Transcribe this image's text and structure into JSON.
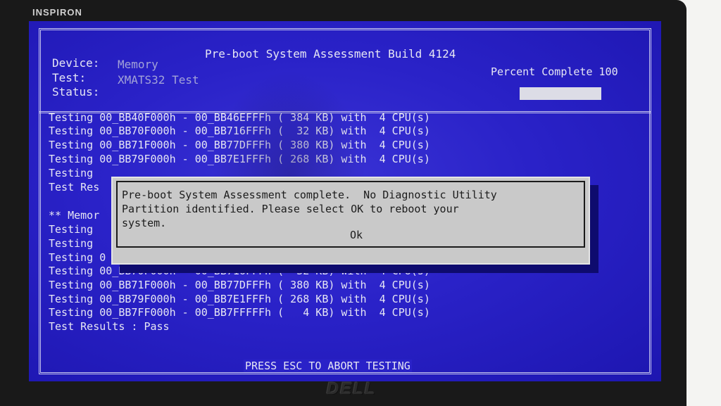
{
  "device": {
    "brand": "INSPIRON",
    "logo": "DELL"
  },
  "header": {
    "title": "Pre-boot System Assessment Build 4124",
    "device_label": "Device:",
    "device_value": "Memory",
    "test_label": "Test:",
    "test_value": "XMATS32 Test",
    "status_label": "Status:",
    "percent_label": "Percent Complete 100",
    "progress": 100
  },
  "log": {
    "lines": [
      "Testing 00_BB40F000h - 00_BB46EFFFh ( 384 KB) with  4 CPU(s)",
      "Testing 00_BB70F000h - 00_BB716FFFh (  32 KB) with  4 CPU(s)",
      "Testing 00_BB71F000h - 00_BB77DFFFh ( 380 KB) with  4 CPU(s)",
      "Testing 00_BB79F000h - 00_BB7E1FFFh ( 268 KB) with  4 CPU(s)",
      "Testing",
      "Test Res",
      "",
      "** Memor",
      "Testing",
      "Testing",
      "Testing 0",
      "Testing 00_BB70F000h - 00_BB716FFFh (  32 KB) with  4 CPU(s)",
      "Testing 00_BB71F000h - 00_BB77DFFFh ( 380 KB) with  4 CPU(s)",
      "Testing 00_BB79F000h - 00_BB7E1FFFh ( 268 KB) with  4 CPU(s)",
      "Testing 00_BB7FF000h - 00_BB7FFFFFh (   4 KB) with  4 CPU(s)",
      "Test Results : Pass"
    ]
  },
  "dialog": {
    "line1": "Pre-boot System Assessment complete.  No Diagnostic Utility",
    "line2": "Partition identified. Please select OK to reboot your",
    "line3": "system.",
    "ok_label": "Ok"
  },
  "footer": {
    "text": "PRESS ESC TO ABORT TESTING"
  },
  "colors": {
    "screen_bg": "#2a22c8",
    "text": "#e6e6f4",
    "dialog_bg": "#c9c9c9"
  }
}
